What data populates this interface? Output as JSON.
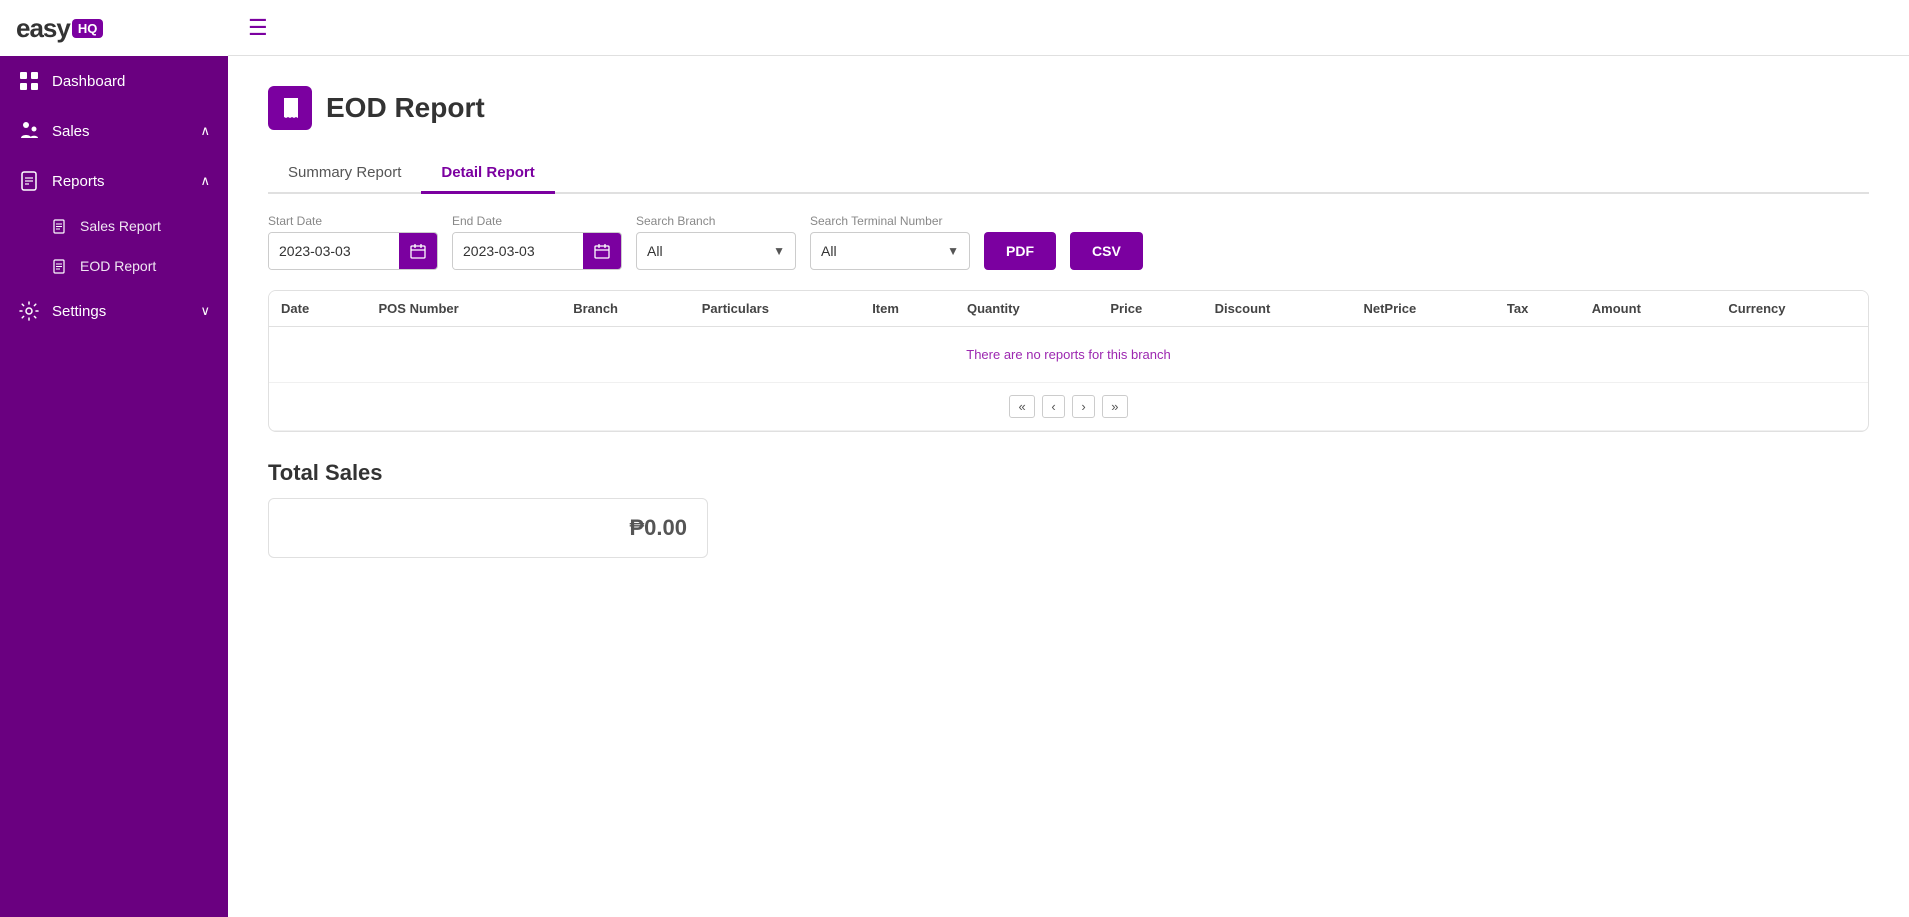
{
  "app": {
    "logo_easy": "easy",
    "logo_hq": "HQ"
  },
  "topbar": {
    "menu_icon": "☰"
  },
  "sidebar": {
    "items": [
      {
        "id": "dashboard",
        "label": "Dashboard",
        "icon": "grid"
      },
      {
        "id": "sales",
        "label": "Sales",
        "icon": "chart",
        "hasChevron": true,
        "chevron": "∧"
      },
      {
        "id": "reports",
        "label": "Reports",
        "icon": "document",
        "hasChevron": true,
        "chevron": "∧"
      }
    ],
    "sub_items_reports": [
      {
        "id": "sales-report",
        "label": "Sales Report",
        "icon": "dollar"
      },
      {
        "id": "eod-report",
        "label": "EOD Report",
        "icon": "list"
      }
    ],
    "settings": {
      "label": "Settings",
      "icon": "gear",
      "chevron": "∨"
    }
  },
  "page": {
    "title": "EOD Report",
    "icon_label": "receipt-icon"
  },
  "tabs": [
    {
      "id": "summary",
      "label": "Summary Report",
      "active": false
    },
    {
      "id": "detail",
      "label": "Detail Report",
      "active": true
    }
  ],
  "filters": {
    "start_date_label": "Start Date",
    "start_date_value": "2023-03-03",
    "end_date_label": "End Date",
    "end_date_value": "2023-03-03",
    "branch_label": "Search Branch",
    "branch_value": "All",
    "terminal_label": "Search Terminal Number",
    "terminal_value": "All",
    "pdf_button": "PDF",
    "csv_button": "CSV"
  },
  "table": {
    "columns": [
      "Date",
      "POS Number",
      "Branch",
      "Particulars",
      "Item",
      "Quantity",
      "Price",
      "Discount",
      "NetPrice",
      "Tax",
      "Amount",
      "Currency"
    ],
    "no_data_message": "There are no reports for this branch",
    "pagination": {
      "first": "«",
      "prev": "‹",
      "next": "›",
      "last": "»"
    }
  },
  "total_sales": {
    "label": "Total Sales",
    "amount": "₱0.00"
  }
}
